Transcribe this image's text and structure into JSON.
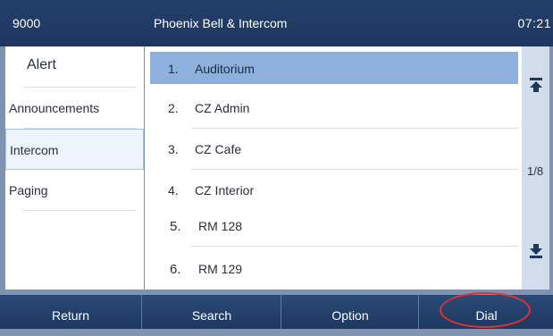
{
  "status": {
    "line_id": "9000",
    "title": "Phoenix Bell & Intercom",
    "clock": "07:21"
  },
  "menu": {
    "items": [
      {
        "label": "Alert"
      },
      {
        "label": "Announcements"
      },
      {
        "label": "Intercom",
        "selected": true
      },
      {
        "label": "Paging"
      }
    ]
  },
  "contacts": {
    "items": [
      {
        "num": "1.",
        "name": "Auditorium",
        "selected": true
      },
      {
        "num": "2.",
        "name": "CZ Admin"
      },
      {
        "num": "3.",
        "name": "CZ Cafe"
      },
      {
        "num": "4.",
        "name": "CZ Interior"
      },
      {
        "num": "5.",
        "name": "RM 128"
      },
      {
        "num": "6.",
        "name": "RM 129"
      }
    ]
  },
  "scroll": {
    "page_indicator": "1/8",
    "top_icon": "scroll-to-top-icon",
    "bottom_icon": "scroll-to-bottom-icon"
  },
  "softkeys": {
    "return": "Return",
    "search": "Search",
    "option": "Option",
    "dial": "Dial"
  },
  "colors": {
    "header": "#1d3860",
    "selection": "#8db0dc",
    "highlight_circle": "#e0332f"
  }
}
